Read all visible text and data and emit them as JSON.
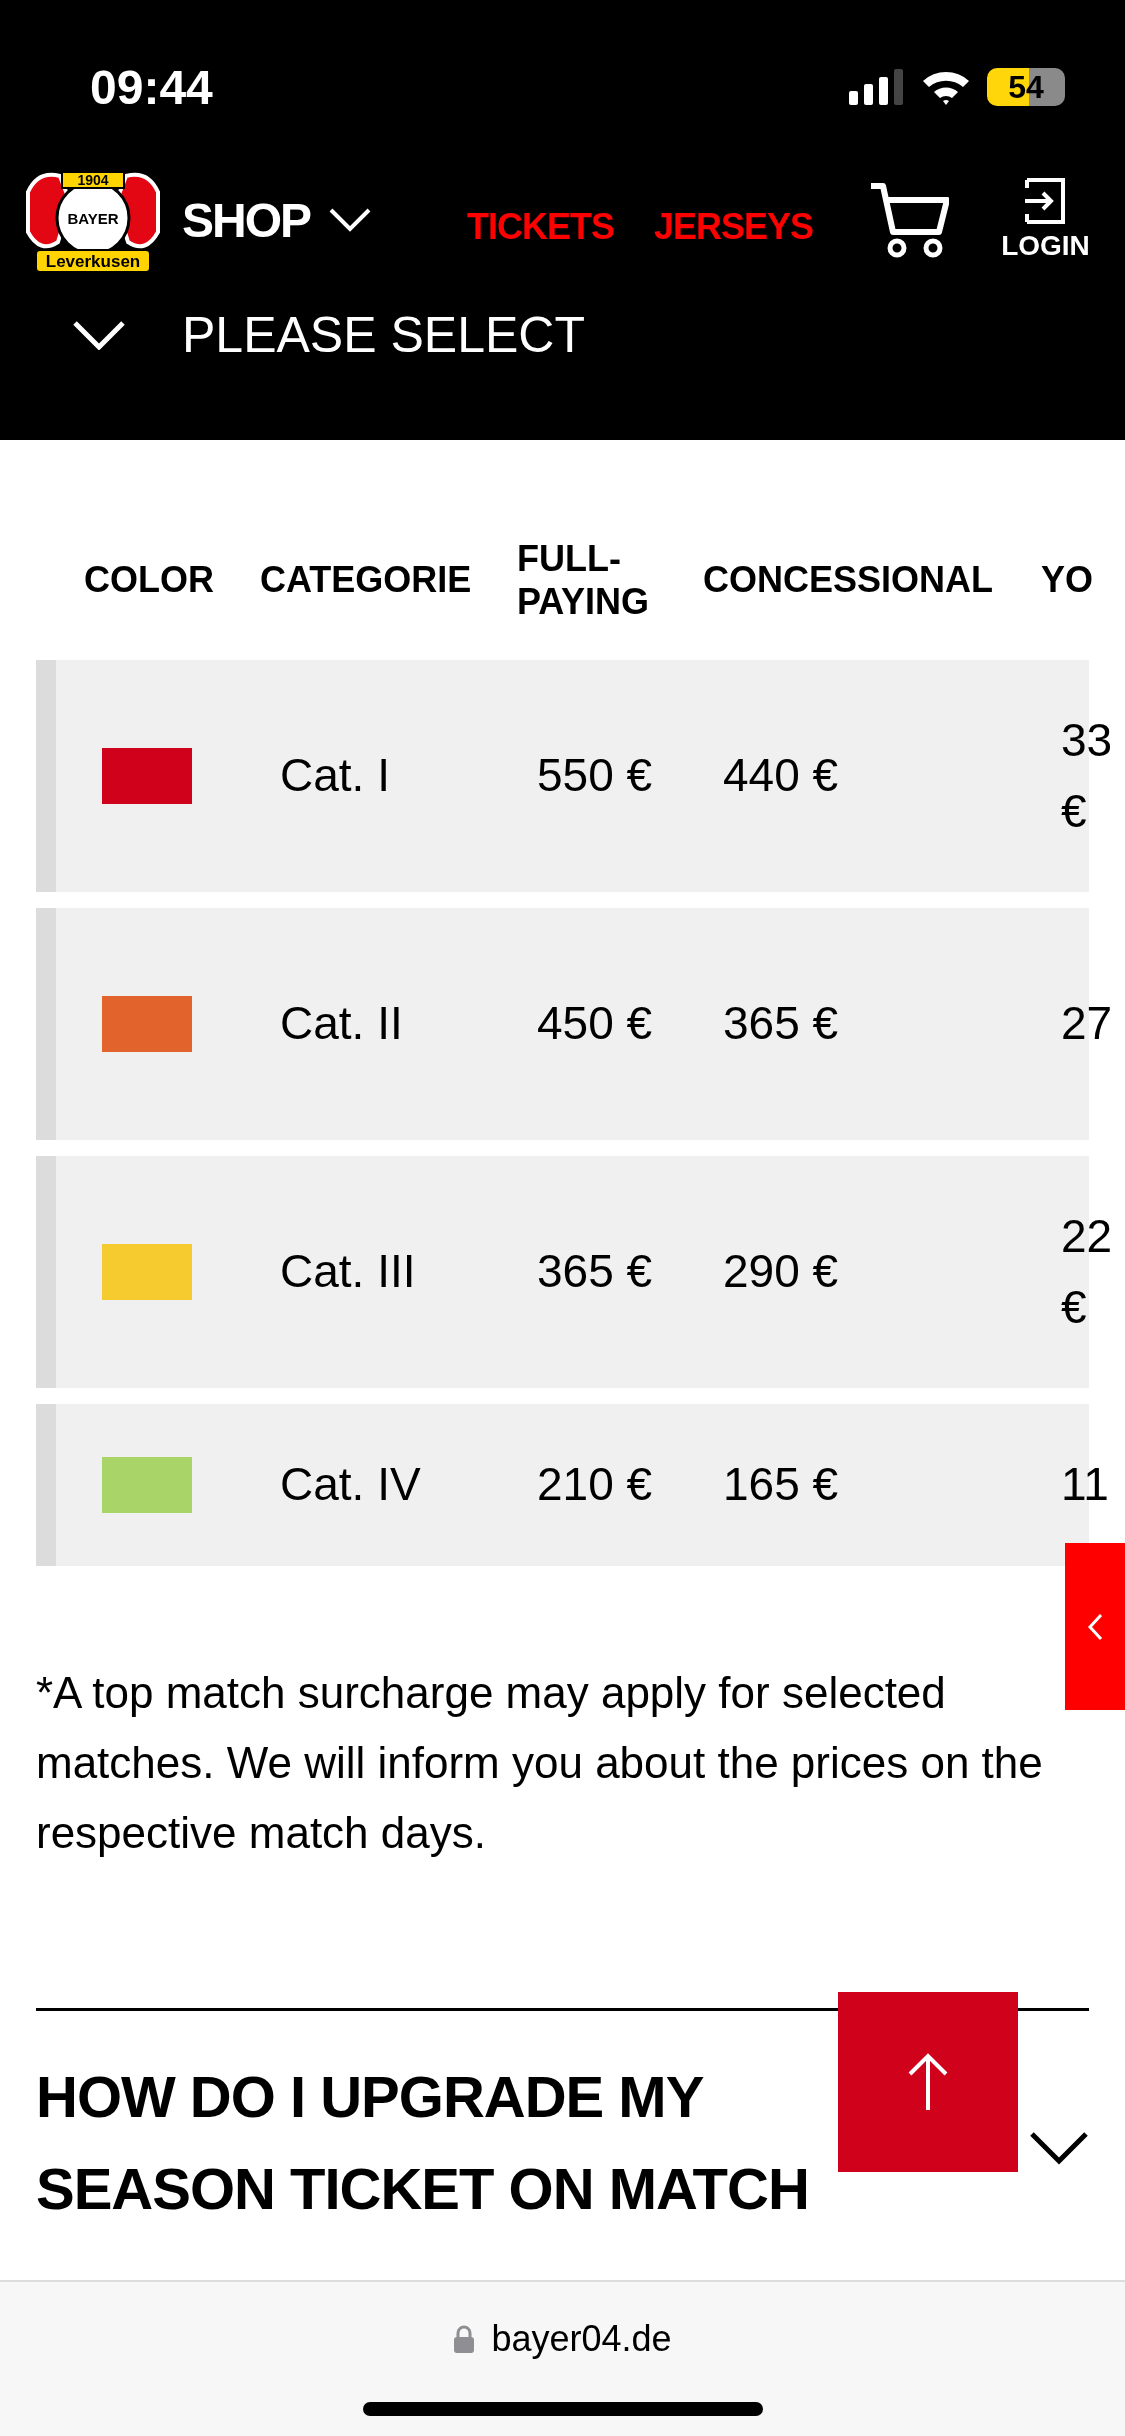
{
  "status_bar": {
    "time": "09:44",
    "battery": "54"
  },
  "nav": {
    "logo": {
      "year": "1904",
      "cross": "BAYER",
      "name": "Leverkusen"
    },
    "shop": "SHOP",
    "links": [
      {
        "label": "TICKETS"
      },
      {
        "label": "JERSEYS"
      }
    ],
    "login": "LOGIN"
  },
  "selector": {
    "label": "PLEASE SELECT"
  },
  "table": {
    "columns": [
      "COLOR",
      "CATEGORIE",
      "FULL-PAYING",
      "CONCESSIONAL",
      "YO"
    ],
    "rows": [
      {
        "color": "#d0021b",
        "category": "Cat. I",
        "full": "550 €",
        "concessional": "440 €",
        "column_5": "33 €"
      },
      {
        "color": "#e2632b",
        "category": "Cat. II",
        "full": "450 €",
        "concessional": "365 €",
        "column_5": "27"
      },
      {
        "color": "#f5cb2f",
        "category": "Cat. III",
        "full": "365 €",
        "concessional": "290 €",
        "column_5": "22 €"
      },
      {
        "color": "#a8d468",
        "category": "Cat. IV",
        "full": "210 €",
        "concessional": "165 €",
        "column_5": "11"
      }
    ]
  },
  "footnote": "*A top match surcharge may apply for selected matches. We will inform you about the prices on the respective match days.",
  "faq": {
    "question": "HOW DO I UPGRADE MY SEASON TICKET ON MATCH",
    "expanded": false
  },
  "browser": {
    "url": "bayer04.de"
  }
}
